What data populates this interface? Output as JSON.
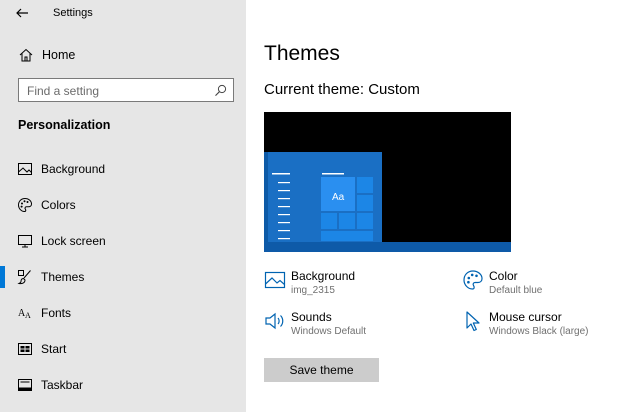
{
  "window": {
    "title": "Settings"
  },
  "sidebar": {
    "home_label": "Home",
    "search_placeholder": "Find a setting",
    "section_title": "Personalization",
    "items": [
      {
        "label": "Background",
        "icon": "picture-icon"
      },
      {
        "label": "Colors",
        "icon": "palette-icon"
      },
      {
        "label": "Lock screen",
        "icon": "monitor-icon"
      },
      {
        "label": "Themes",
        "icon": "brush-icon",
        "selected": true
      },
      {
        "label": "Fonts",
        "icon": "font-icon"
      },
      {
        "label": "Start",
        "icon": "start-icon"
      },
      {
        "label": "Taskbar",
        "icon": "taskbar-icon"
      }
    ]
  },
  "main": {
    "title": "Themes",
    "current_theme": "Current theme: Custom",
    "preview": {
      "sample_text": "Aa"
    },
    "properties": [
      {
        "name": "Background",
        "value": "img_2315",
        "icon": "picture-icon"
      },
      {
        "name": "Color",
        "value": "Default blue",
        "icon": "palette-icon"
      },
      {
        "name": "Sounds",
        "value": "Windows Default",
        "icon": "speaker-icon"
      },
      {
        "name": "Mouse cursor",
        "value": "Windows Black (large)",
        "icon": "cursor-icon"
      }
    ],
    "save_label": "Save theme"
  },
  "colors": {
    "accent": "#0078d7",
    "sidebar_bg": "#e6e6e6",
    "button_bg": "#cccccc"
  }
}
